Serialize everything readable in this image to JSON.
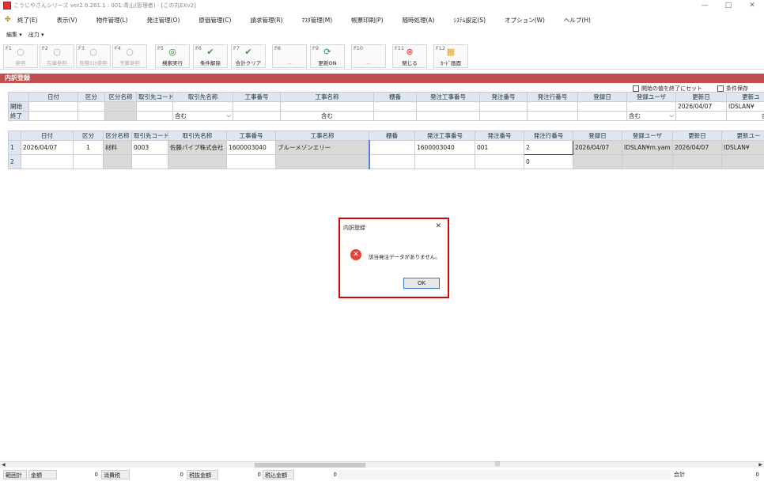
{
  "window": {
    "title": "こうじやさんシリーズ  ver2.6.261.1 : 001:青山(管理者) - [この丸EXv2]",
    "minimize": "—",
    "maximize": "□",
    "close": "✕"
  },
  "menu": [
    "終了(E)",
    "表示(V)",
    "物件管理(L)",
    "発注管理(O)",
    "原価管理(C)",
    "請求管理(R)",
    "ﾏｽﾀ管理(M)",
    "帳票印刷(P)",
    "随時処理(A)",
    "ｼｽﾃﾑ設定(S)",
    "オプション(W)",
    "ヘルプ(H)"
  ],
  "subbar": {
    "edit": "編集 ▾",
    "output": "出力 ▾"
  },
  "fkeys": [
    {
      "key": "F1",
      "label": "参照",
      "icon": "○",
      "disabled": true
    },
    {
      "key": "F2",
      "label": "在庫参照",
      "icon": "○",
      "disabled": true
    },
    {
      "key": "F3",
      "label": "見積ﾏｽﾀ参照",
      "icon": "○",
      "disabled": true
    },
    {
      "key": "F4",
      "label": "予算参照",
      "icon": "○",
      "disabled": true
    },
    {
      "key": "F5",
      "label": "検索実行",
      "icon": "◎",
      "disabled": false
    },
    {
      "key": "F6",
      "label": "条件解除",
      "icon": "✔",
      "disabled": false
    },
    {
      "key": "F7",
      "label": "合計クリア",
      "icon": "✔",
      "disabled": false
    },
    {
      "key": "F8",
      "label": "—",
      "icon": "",
      "disabled": true
    },
    {
      "key": "F9",
      "label": "更新ON",
      "icon": "⟳",
      "disabled": false
    },
    {
      "key": "F10",
      "label": "—",
      "icon": "",
      "disabled": true
    },
    {
      "key": "F11",
      "label": "閉じる",
      "icon": "⊗",
      "disabled": false
    },
    {
      "key": "F12",
      "label": "ｶｰﾄﾞ画面",
      "icon": "▦",
      "disabled": false
    }
  ],
  "section_title": "内訳登録",
  "options": {
    "keep_start": "開始の値を終了にセット",
    "save_cond": "条件保存"
  },
  "filter": {
    "headers": [
      "日付",
      "区分",
      "区分名称",
      "取引先コード",
      "取引先名称",
      "工事番号",
      "工事名称",
      "棚番",
      "発注工事番号",
      "発注番号",
      "発注行番号",
      "登録日",
      "登録ユーザ",
      "更新日",
      "更新ユ"
    ],
    "start_label": "開始",
    "end_label": "終了",
    "include": "含む",
    "update_date_start": "2026/04/07",
    "update_user": "IDSLAN¥",
    "include2": "含む"
  },
  "result": {
    "headers": [
      "日付",
      "区分",
      "区分名称",
      "取引先コード",
      "取引先名称",
      "工事番号",
      "工事名称",
      "棚番",
      "発注工事番号",
      "発注番号",
      "発注行番号",
      "登録日",
      "登録ユーザ",
      "更新日",
      "更新ユー"
    ],
    "rows": [
      {
        "no": "1",
        "date": "2026/04/07",
        "kubun": "1",
        "kubun_name": "材料",
        "torihiki_code": "0003",
        "torihiki_name": "佐藤パイプ株式会社",
        "koji_no": "1600003040",
        "koji_name": "ブルーメゾンエリー",
        "tana": "",
        "hachu_koji": "1600003040",
        "hachu_no": "001",
        "hachu_line": "2",
        "reg_date": "2026/04/07",
        "reg_user": "IDSLAN¥m.yam",
        "upd_date": "2026/04/07",
        "upd_user": "IDSLAN¥"
      },
      {
        "no": "2",
        "date": "",
        "kubun": "",
        "kubun_name": "",
        "torihiki_code": "",
        "torihiki_name": "",
        "koji_no": "",
        "koji_name": "",
        "tana": "",
        "hachu_koji": "",
        "hachu_no": "",
        "hachu_line": "0",
        "reg_date": "",
        "reg_user": "",
        "upd_date": "",
        "upd_user": ""
      }
    ]
  },
  "dialog": {
    "title": "内訳登録",
    "message": "該当発注データがありません。",
    "ok": "OK",
    "close": "✕",
    "icon": "✕"
  },
  "status": {
    "range_total": "範囲計",
    "amount_label": "金額",
    "amount": "0",
    "tax_label": "消費税",
    "tax": "0",
    "excl_label": "税抜金額",
    "excl": "0",
    "incl_label": "税込金額",
    "incl": "0",
    "extra": "0",
    "total_label": "合計",
    "total": "0"
  }
}
